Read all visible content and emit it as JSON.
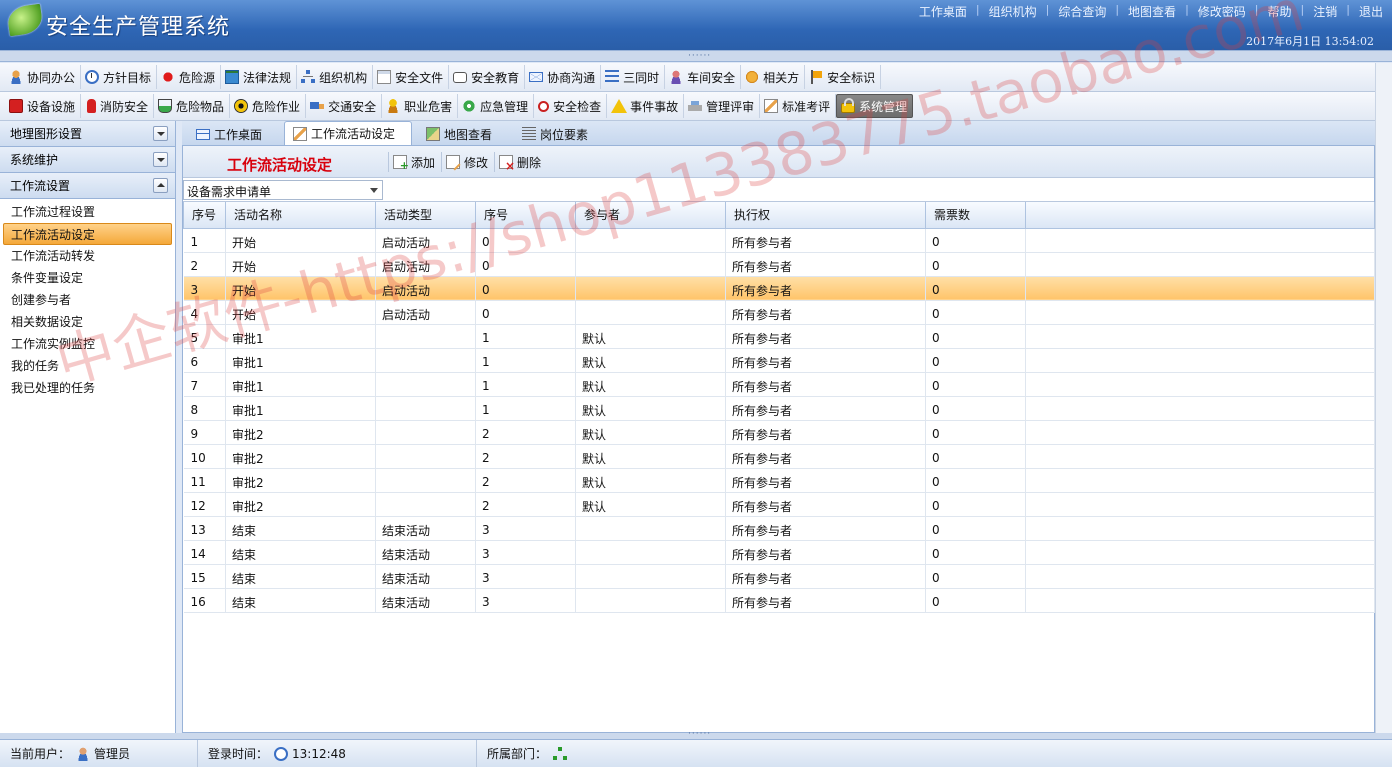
{
  "app": {
    "title": "安全生产管理系统",
    "datetime": "2017年6月1日  13:54:02",
    "top_links": [
      "工作桌面",
      "组织机构",
      "综合查询",
      "地图查看",
      "修改密码",
      "帮助",
      "注销",
      "退出"
    ]
  },
  "menu_row1": [
    {
      "label": "协同办公",
      "icon": "people-icon",
      "cls": "people"
    },
    {
      "label": "方针目标",
      "icon": "clock-icon",
      "cls": "clock"
    },
    {
      "label": "危险源",
      "icon": "red-dot-icon",
      "cls": "dot"
    },
    {
      "label": "法律法规",
      "icon": "book-icon",
      "cls": "book"
    },
    {
      "label": "组织机构",
      "icon": "org-chart-icon",
      "cls": "org"
    },
    {
      "label": "安全文件",
      "icon": "document-icon",
      "cls": "file"
    },
    {
      "label": "安全教育",
      "icon": "speech-bubble-icon",
      "cls": "speech"
    },
    {
      "label": "协商沟通",
      "icon": "mail-icon",
      "cls": "mail"
    },
    {
      "label": "三同时",
      "icon": "list-icon",
      "cls": "list"
    },
    {
      "label": "车间安全",
      "icon": "person-icon",
      "cls": "person"
    },
    {
      "label": "相关方",
      "icon": "handshake-icon",
      "cls": "hands"
    },
    {
      "label": "安全标识",
      "icon": "flag-icon",
      "cls": "flag"
    }
  ],
  "menu_row2": [
    {
      "label": "设备设施",
      "icon": "equipment-icon",
      "cls": "redbox"
    },
    {
      "label": "消防安全",
      "icon": "extinguisher-icon",
      "cls": "extinguisher"
    },
    {
      "label": "危险物品",
      "icon": "flask-icon",
      "cls": "flask"
    },
    {
      "label": "危险作业",
      "icon": "hazard-icon",
      "cls": "hazard"
    },
    {
      "label": "交通安全",
      "icon": "truck-icon",
      "cls": "truck"
    },
    {
      "label": "职业危害",
      "icon": "worker-icon",
      "cls": "worker"
    },
    {
      "label": "应急管理",
      "icon": "gear-icon",
      "cls": "gear"
    },
    {
      "label": "安全检查",
      "icon": "magnifier-icon",
      "cls": "magnify"
    },
    {
      "label": "事件事故",
      "icon": "warning-icon",
      "cls": "warn"
    },
    {
      "label": "管理评审",
      "icon": "review-icon",
      "cls": "review"
    },
    {
      "label": "标准考评",
      "icon": "pencil-icon",
      "cls": "pencil"
    },
    {
      "label": "系统管理",
      "icon": "lock-icon",
      "cls": "lock",
      "active": true
    }
  ],
  "sidebar": {
    "sections": [
      "地理图形设置",
      "系统维护",
      "工作流设置"
    ],
    "items": [
      "工作流过程设置",
      "工作流活动设定",
      "工作流活动转发",
      "条件变量设定",
      "创建参与者",
      "相关数据设定",
      "工作流实例监控",
      "我的任务",
      "我已处理的任务"
    ],
    "selected_index": 1
  },
  "tabs": [
    {
      "label": "工作桌面",
      "icon": "desktop-icon",
      "cls": "desk"
    },
    {
      "label": "工作流活动设定",
      "icon": "edit-icon",
      "cls": "pencil",
      "active": true
    },
    {
      "label": "地图查看",
      "icon": "map-icon",
      "cls": "map"
    },
    {
      "label": "岗位要素",
      "icon": "lines-icon",
      "cls": "lines"
    }
  ],
  "content": {
    "title": "工作流活动设定",
    "buttons": {
      "add": "添加",
      "edit": "修改",
      "delete": "删除"
    },
    "combo_value": "设备需求申请单"
  },
  "table": {
    "columns": [
      "序号",
      "活动名称",
      "活动类型",
      "序号",
      "参与者",
      "执行权",
      "需票数"
    ],
    "rows": [
      [
        "1",
        "开始",
        "启动活动",
        "0",
        "",
        "所有参与者",
        "0"
      ],
      [
        "2",
        "开始",
        "启动活动",
        "0",
        "",
        "所有参与者",
        "0"
      ],
      [
        "3",
        "开始",
        "启动活动",
        "0",
        "",
        "所有参与者",
        "0"
      ],
      [
        "4",
        "开始",
        "启动活动",
        "0",
        "",
        "所有参与者",
        "0"
      ],
      [
        "5",
        "审批1",
        "",
        "1",
        "默认",
        "所有参与者",
        "0"
      ],
      [
        "6",
        "审批1",
        "",
        "1",
        "默认",
        "所有参与者",
        "0"
      ],
      [
        "7",
        "审批1",
        "",
        "1",
        "默认",
        "所有参与者",
        "0"
      ],
      [
        "8",
        "审批1",
        "",
        "1",
        "默认",
        "所有参与者",
        "0"
      ],
      [
        "9",
        "审批2",
        "",
        "2",
        "默认",
        "所有参与者",
        "0"
      ],
      [
        "10",
        "审批2",
        "",
        "2",
        "默认",
        "所有参与者",
        "0"
      ],
      [
        "11",
        "审批2",
        "",
        "2",
        "默认",
        "所有参与者",
        "0"
      ],
      [
        "12",
        "审批2",
        "",
        "2",
        "默认",
        "所有参与者",
        "0"
      ],
      [
        "13",
        "结束",
        "结束活动",
        "3",
        "",
        "所有参与者",
        "0"
      ],
      [
        "14",
        "结束",
        "结束活动",
        "3",
        "",
        "所有参与者",
        "0"
      ],
      [
        "15",
        "结束",
        "结束活动",
        "3",
        "",
        "所有参与者",
        "0"
      ],
      [
        "16",
        "结束",
        "结束活动",
        "3",
        "",
        "所有参与者",
        "0"
      ]
    ],
    "selected_row": 2
  },
  "watermark": "中企软件-https://shop113383775.taobao.com",
  "status": {
    "user_label": "当前用户：",
    "user_value": "管理员",
    "login_label": "登录时间：",
    "login_value": "13:12:48",
    "dept_label": "所属部门："
  }
}
